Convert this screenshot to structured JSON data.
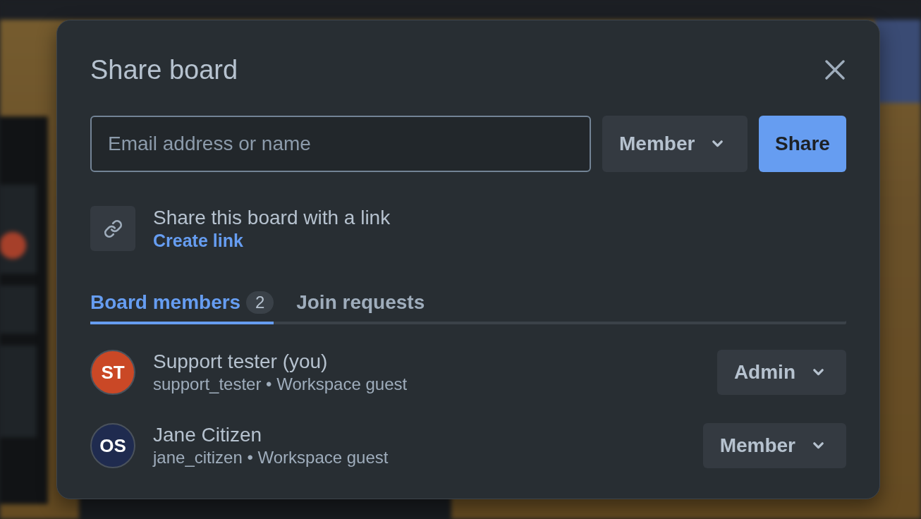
{
  "dialog": {
    "title": "Share board"
  },
  "invite": {
    "placeholder": "Email address or name",
    "role": "Member",
    "button": "Share"
  },
  "link_sharing": {
    "text": "Share this board with a link",
    "link": "Create link"
  },
  "tabs": [
    {
      "label": "Board members",
      "count": "2",
      "selected": true
    },
    {
      "label": "Join requests",
      "selected": false
    }
  ],
  "members": [
    {
      "initials": "ST",
      "color": "#ca4826",
      "name": "Support tester (you)",
      "detail": "support_tester • Workspace guest",
      "role": "Admin"
    },
    {
      "initials": "OS",
      "color": "#1f2b4f",
      "name": "Jane Citizen",
      "detail": "jane_citizen • Workspace guest",
      "role": "Member"
    }
  ]
}
